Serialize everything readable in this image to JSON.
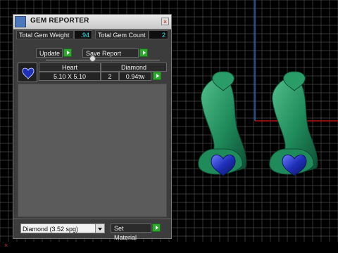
{
  "window": {
    "title": "GEM REPORTER",
    "close_glyph": "×"
  },
  "summary": {
    "weight_label": "Total Gem Weight",
    "weight_value": ".94",
    "count_label": "Total Gem Count",
    "count_value": "2"
  },
  "actions": {
    "update_label": "Update",
    "save_label": "Save Report"
  },
  "gems": [
    {
      "shape": "Heart",
      "type": "Diamond",
      "size": "5.10 X 5.10",
      "qty": "2",
      "weight": "0.94tw"
    }
  ],
  "material": {
    "selected": "Diamond    (3.52 spg)",
    "set_label": "Set Material"
  },
  "colors": {
    "viewport_bg": "#000000",
    "grid": "#5f5f5f",
    "axis_blue": "#1c6fd6",
    "axis_red": "#b01212",
    "jewelry_green": "#1f8a5a",
    "gem_blue": "#1e2fb8",
    "panel_bg": "#3c3c3c"
  }
}
